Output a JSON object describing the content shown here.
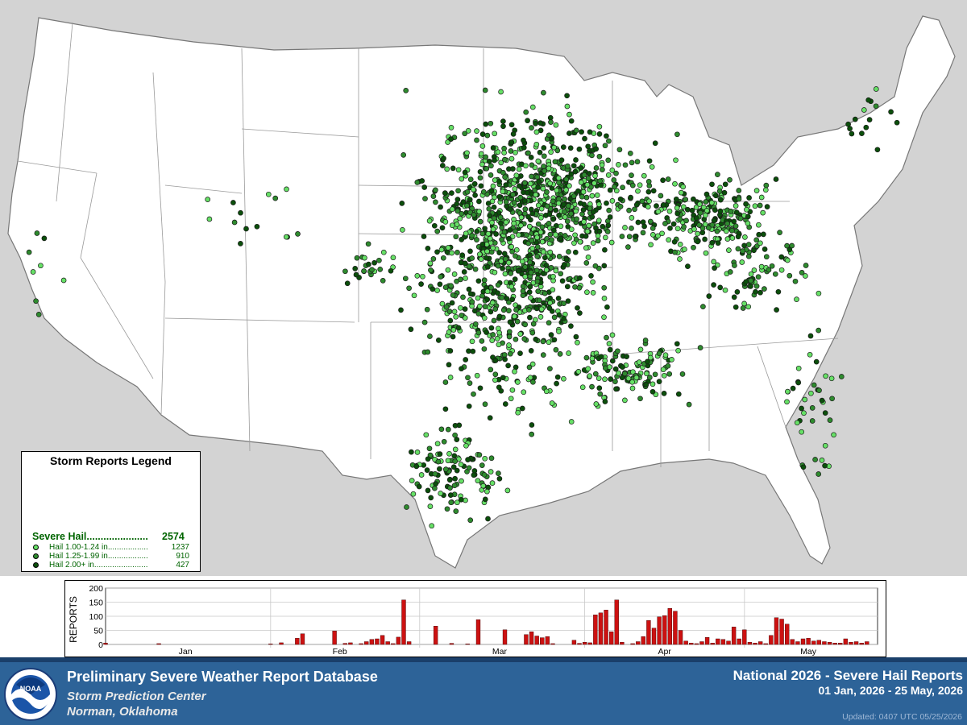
{
  "legend": {
    "title": "Storm Reports Legend",
    "summary_label": "Severe Hail......................",
    "summary_count": "2574",
    "items": [
      {
        "label": "Hail 1.00-1.24 in..................",
        "count": "1237",
        "color": "#66e066"
      },
      {
        "label": "Hail 1.25-1.99 in..................",
        "count": "910",
        "color": "#2e8b2e"
      },
      {
        "label": "Hail 2.00+ in........................",
        "count": "427",
        "color": "#0b4f0b"
      }
    ]
  },
  "chart_data": {
    "type": "bar",
    "ylabel": "REPORTS",
    "ylim": [
      0,
      200
    ],
    "yticks": [
      "200",
      "150",
      "100",
      "50",
      "0"
    ],
    "month_labels": [
      "Jan",
      "Feb",
      "Mar",
      "Apr",
      "May"
    ],
    "bar_color": "#cc1111",
    "x": [
      "2026-01-01",
      "2026-01-11",
      "2026-02-01",
      "2026-02-03",
      "2026-02-06",
      "2026-02-07",
      "2026-02-13",
      "2026-02-15",
      "2026-02-16",
      "2026-02-18",
      "2026-02-19",
      "2026-02-20",
      "2026-02-21",
      "2026-02-22",
      "2026-02-23",
      "2026-02-24",
      "2026-02-25",
      "2026-02-26",
      "2026-02-27",
      "2026-03-04",
      "2026-03-07",
      "2026-03-10",
      "2026-03-12",
      "2026-03-17",
      "2026-03-21",
      "2026-03-22",
      "2026-03-23",
      "2026-03-24",
      "2026-03-25",
      "2026-03-26",
      "2026-03-30",
      "2026-03-31",
      "2026-04-01",
      "2026-04-02",
      "2026-04-03",
      "2026-04-04",
      "2026-04-05",
      "2026-04-06",
      "2026-04-07",
      "2026-04-08",
      "2026-04-10",
      "2026-04-11",
      "2026-04-12",
      "2026-04-13",
      "2026-04-14",
      "2026-04-15",
      "2026-04-16",
      "2026-04-17",
      "2026-04-18",
      "2026-04-19",
      "2026-04-20",
      "2026-04-21",
      "2026-04-22",
      "2026-04-23",
      "2026-04-24",
      "2026-04-25",
      "2026-04-26",
      "2026-04-27",
      "2026-04-28",
      "2026-04-29",
      "2026-04-30",
      "2026-05-01",
      "2026-05-02",
      "2026-05-03",
      "2026-05-04",
      "2026-05-05",
      "2026-05-06",
      "2026-05-07",
      "2026-05-08",
      "2026-05-09",
      "2026-05-10",
      "2026-05-11",
      "2026-05-12",
      "2026-05-13",
      "2026-05-14",
      "2026-05-15",
      "2026-05-16",
      "2026-05-17",
      "2026-05-18",
      "2026-05-19",
      "2026-05-20",
      "2026-05-21",
      "2026-05-22",
      "2026-05-23",
      "2026-05-24"
    ],
    "values": [
      5,
      3,
      2,
      6,
      22,
      38,
      48,
      4,
      6,
      3,
      10,
      18,
      20,
      32,
      10,
      3,
      26,
      158,
      10,
      65,
      4,
      2,
      88,
      52,
      35,
      45,
      30,
      24,
      28,
      3,
      15,
      4,
      8,
      6,
      105,
      112,
      122,
      45,
      158,
      8,
      3,
      10,
      28,
      85,
      58,
      98,
      102,
      128,
      118,
      50,
      12,
      5,
      3,
      10,
      25,
      5,
      20,
      18,
      12,
      62,
      20,
      52,
      8,
      5,
      10,
      3,
      32,
      95,
      90,
      72,
      18,
      10,
      20,
      22,
      12,
      15,
      10,
      8,
      5,
      5,
      20,
      8,
      10,
      5,
      10
    ]
  },
  "footer": {
    "db_title": "Preliminary Severe Weather Report Database",
    "org": "Storm Prediction Center",
    "location": "Norman, Oklahoma",
    "report_title": "National  2026 - Severe Hail Reports",
    "date_range": "01 Jan, 2026 - 25 May, 2026",
    "updated": "Updated: 0407 UTC 05/25/2026",
    "logo_text": "NOAA"
  }
}
